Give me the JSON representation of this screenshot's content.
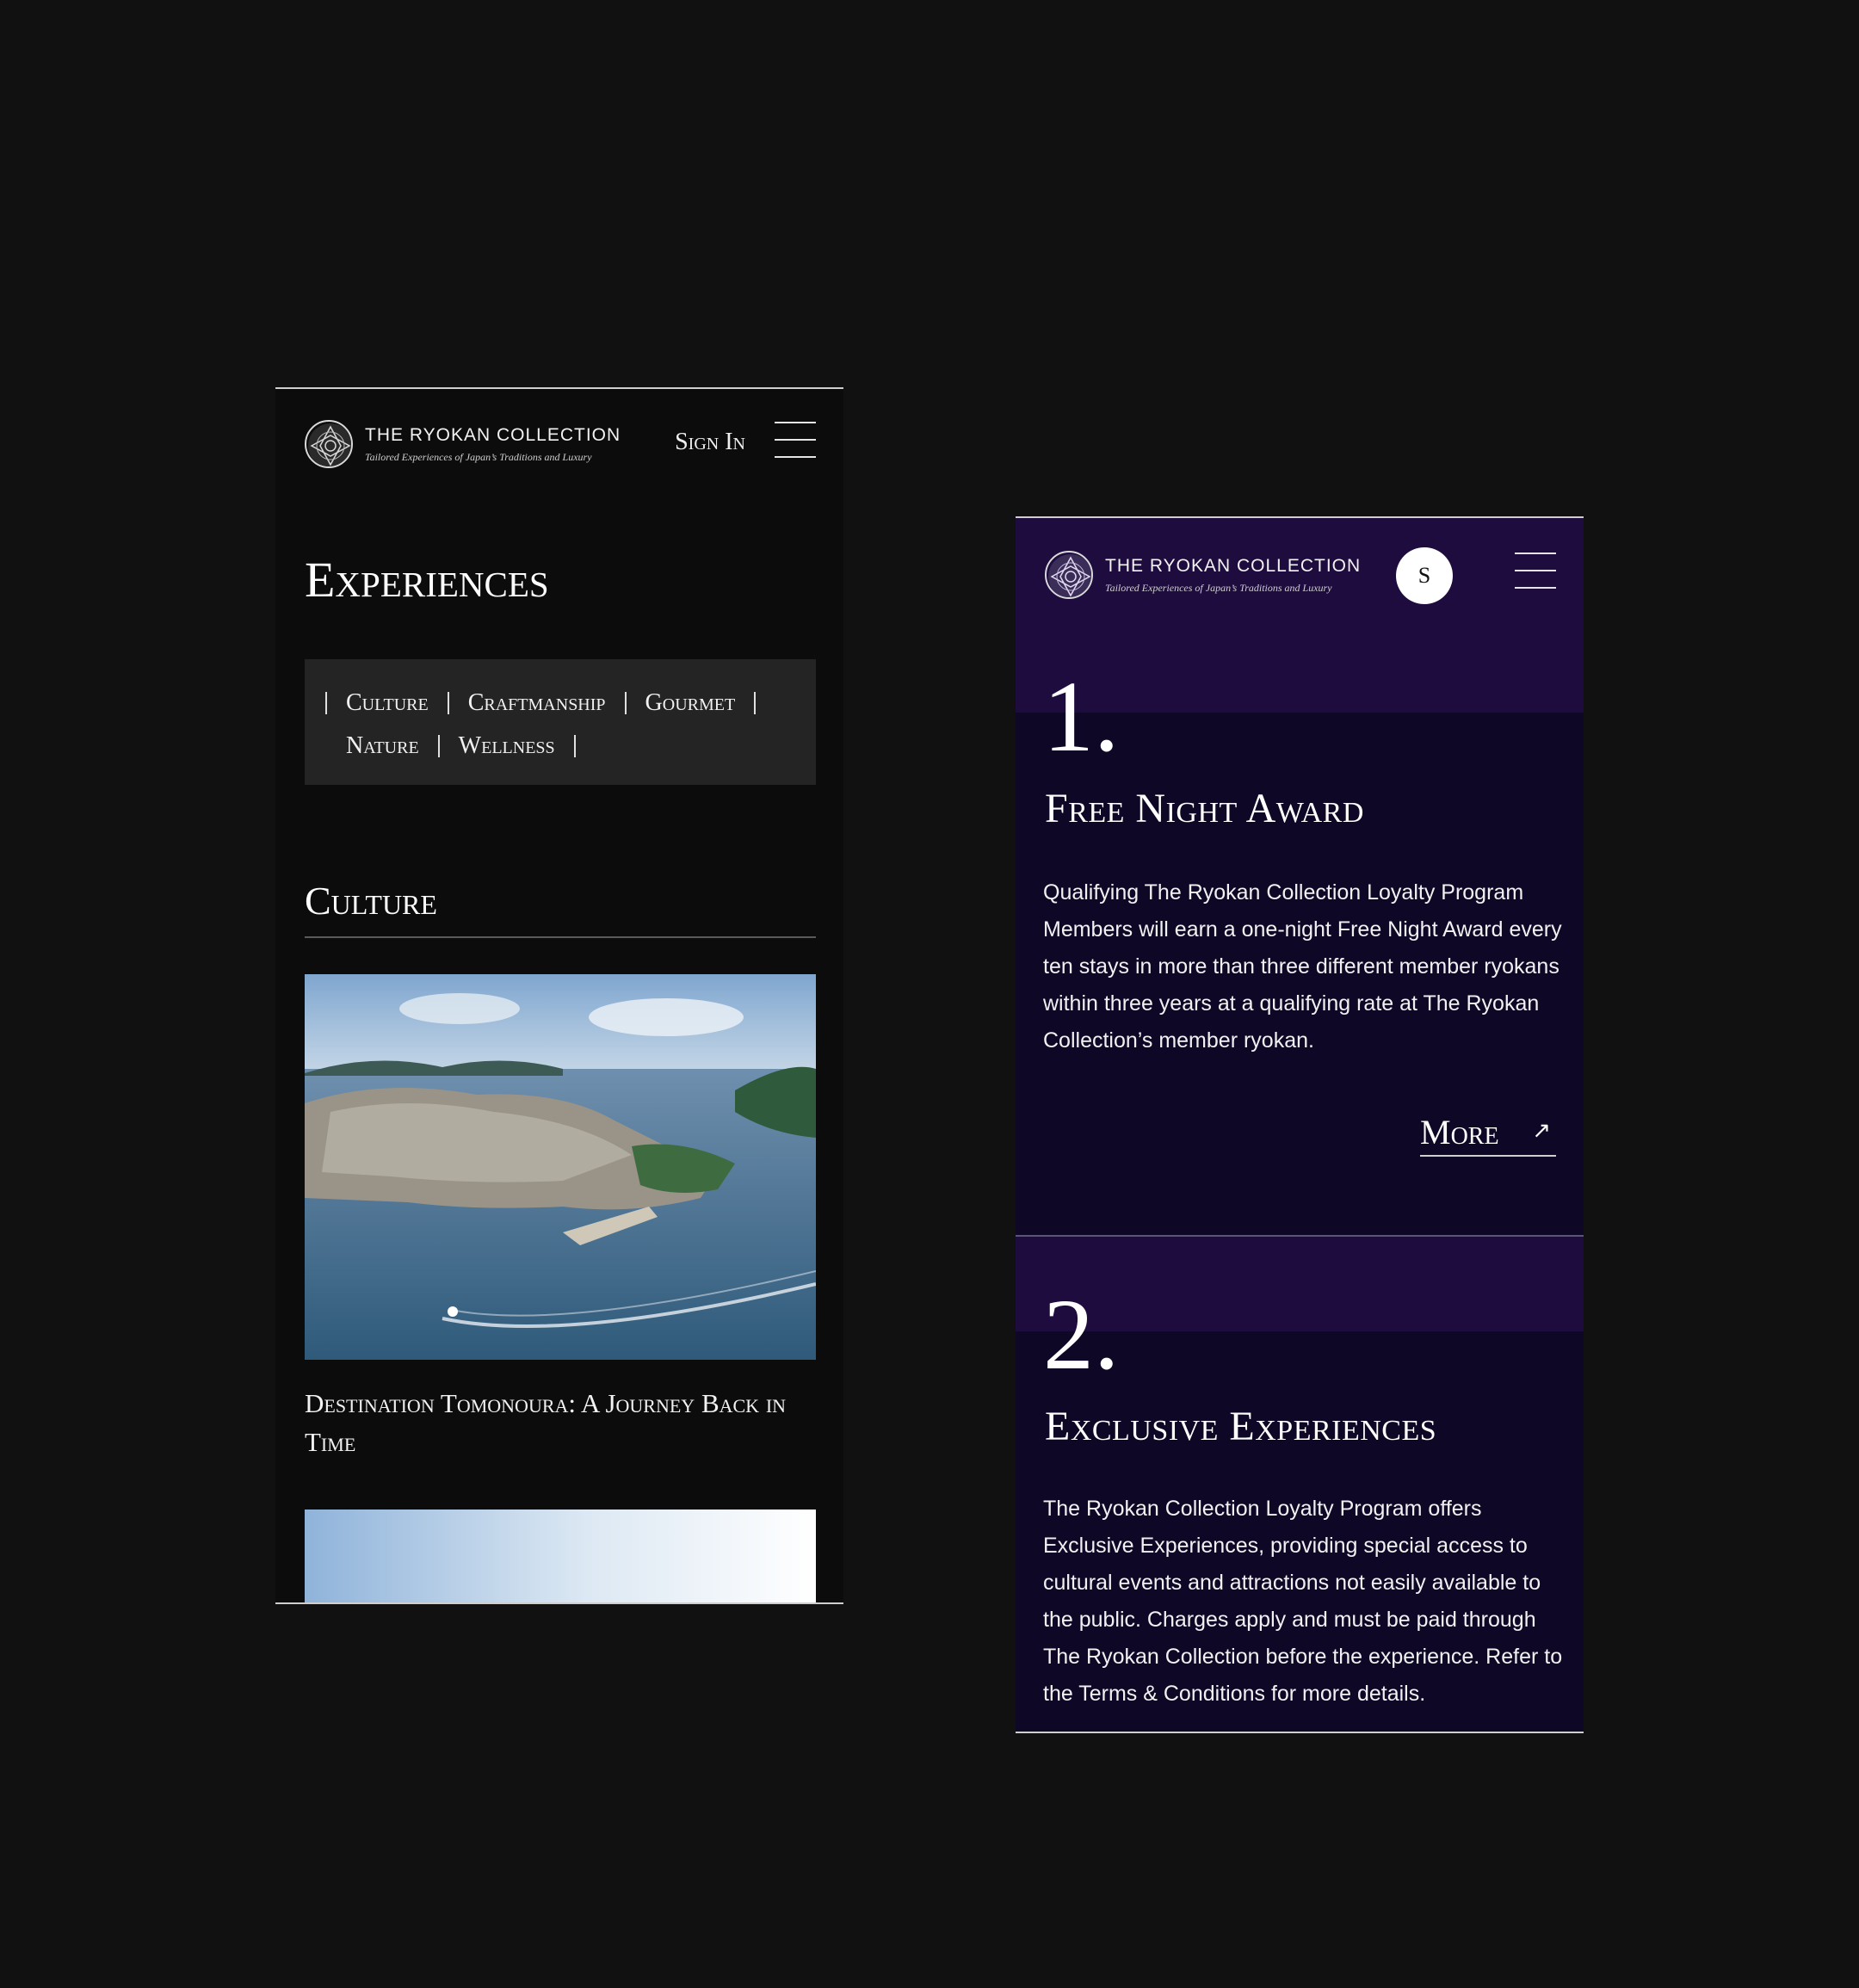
{
  "brand": {
    "name": "THE RYOKAN COLLECTION",
    "tagline": "Tailored Experiences of Japan’s Traditions and Luxury"
  },
  "left_screen": {
    "header": {
      "sign_in": "Sign In"
    },
    "page_title": "Experiences",
    "categories": [
      "Culture",
      "Craftmanship",
      "Gourmet",
      "Nature",
      "Wellness"
    ],
    "section": {
      "heading": "Culture",
      "article_title": "Destination Tomonoura: A Journey Back in Time"
    }
  },
  "right_screen": {
    "header": {
      "avatar_initial": "S"
    },
    "benefits": [
      {
        "number": "1.",
        "title": "Free Night Award",
        "body": "Qualifying The Ryokan Collection Loyalty Program Members will earn a one-night Free Night Award every ten stays in more than three different member ryokans within three years at a qualifying rate at The Ryokan Collection’s member ryokan.",
        "link": "More",
        "link_icon": "↗"
      },
      {
        "number": "2.",
        "title": "Exclusive Experiences",
        "body": "The Ryokan Collection Loyalty Program offers Exclusive Experiences, providing special access to cultural events and attractions not easily available to the public. Charges apply and must be paid through The Ryokan Collection before the experience. Refer to the Terms & Conditions for more details."
      }
    ]
  },
  "colors": {
    "background": "#111111",
    "left_bg": "#0c0c0c",
    "category_box": "#242424",
    "right_bg": "#0e0726",
    "right_band": "#1e0c3f"
  }
}
